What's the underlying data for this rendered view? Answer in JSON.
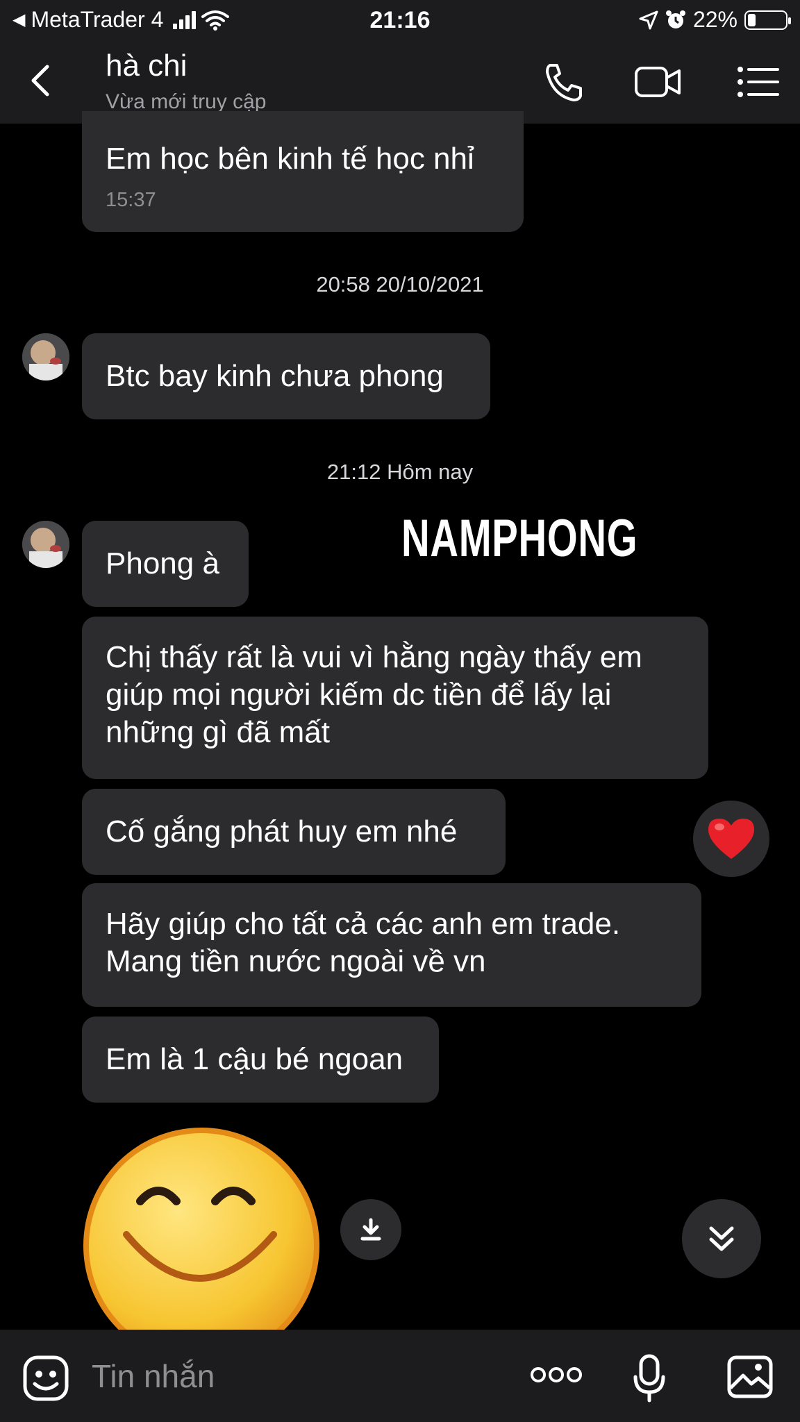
{
  "status_bar": {
    "back_app": "MetaTrader 4",
    "time": "21:16",
    "battery": "22%",
    "battery_level": 0.22
  },
  "header": {
    "contact_name": "hà chi",
    "status": "Vừa mới truy cập",
    "icons": [
      "back-chevron-icon",
      "phone-icon",
      "video-call-icon",
      "menu-list-icon"
    ]
  },
  "messages": [
    {
      "text": "Em học bên kinh tế học nhỉ",
      "time": "15:37"
    },
    {
      "separator": "20:58 20/10/2021"
    },
    {
      "text": "Btc bay kinh chưa phong"
    },
    {
      "separator": "21:12 Hôm nay"
    },
    {
      "text": "Phong à"
    },
    {
      "text": "Chị thấy rất là vui vì hằng ngày thấy em giúp mọi người kiếm dc tiền để lấy lại những gì đã mất"
    },
    {
      "text": "Cố gắng phát huy em nhé",
      "reaction": "heart-icon"
    },
    {
      "text": "Hãy giúp  cho tất cả các anh em trade. Mang tiền nước ngoài về vn"
    },
    {
      "text": "Em là 1 cậu bé ngoan"
    },
    {
      "sticker": "smiley-sticker"
    }
  ],
  "watermark": "NAMPHONG",
  "composer": {
    "placeholder": "Tin nhắn",
    "icons": [
      "emoji-icon",
      "more-dots-icon",
      "microphone-icon",
      "image-icon"
    ]
  },
  "colors": {
    "background": "#000000",
    "bar": "#1c1c1e",
    "bubble": "#2c2c2e",
    "secondary_text": "#8e8e93",
    "heart": "#e8202a",
    "sticker": "#f7c531"
  }
}
